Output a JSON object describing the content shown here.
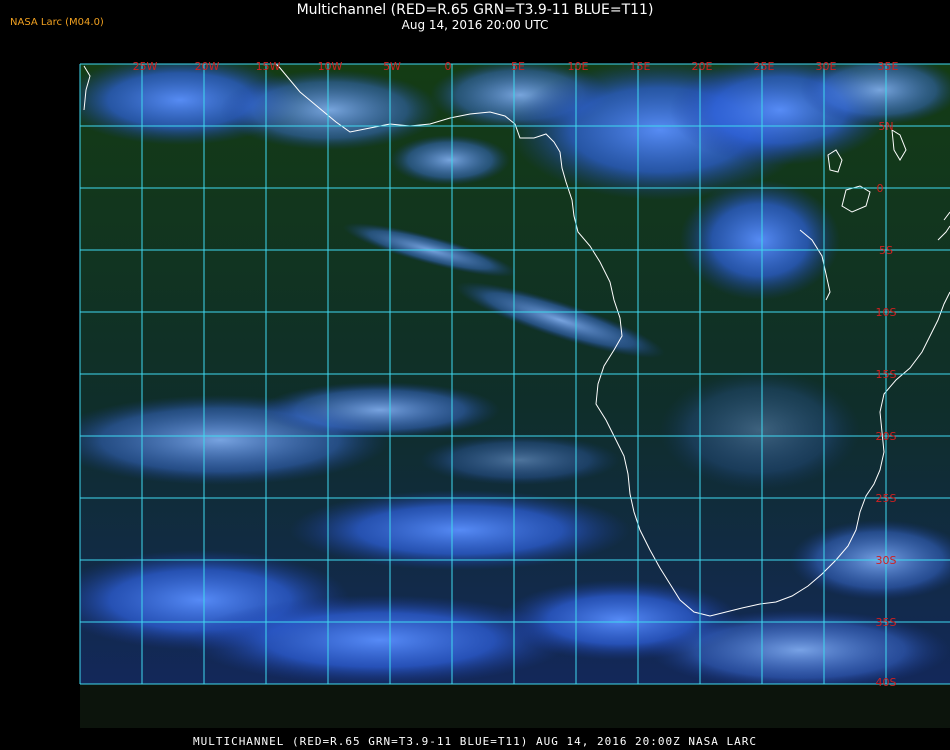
{
  "header": {
    "title": "Multichannel (RED=R.65 GRN=T3.9-11 BLUE=T11)",
    "datetime": "Aug 14, 2016 20:00 UTC",
    "logo": "NASA Larc (M04.0)"
  },
  "footer": {
    "caption": "MULTICHANNEL (RED=R.65 GRN=T3.9-11 BLUE=T11) AUG 14, 2016 20:00Z   NASA LARC"
  },
  "map": {
    "longitude_labels": [
      "25W",
      "20W",
      "15W",
      "10W",
      "5W",
      "0",
      "5E",
      "10E",
      "15E",
      "20E",
      "25E",
      "30E",
      "35E"
    ],
    "latitude_labels": [
      "5N",
      "0",
      "5S",
      "10S",
      "15S",
      "20S",
      "25S",
      "30S",
      "35S",
      "40S"
    ],
    "colors": {
      "grid": "#3fd8f0",
      "labels": "#d02020",
      "coastline": "#ffffff",
      "ocean": "#123a12",
      "cloud": "#3a78ff"
    }
  }
}
